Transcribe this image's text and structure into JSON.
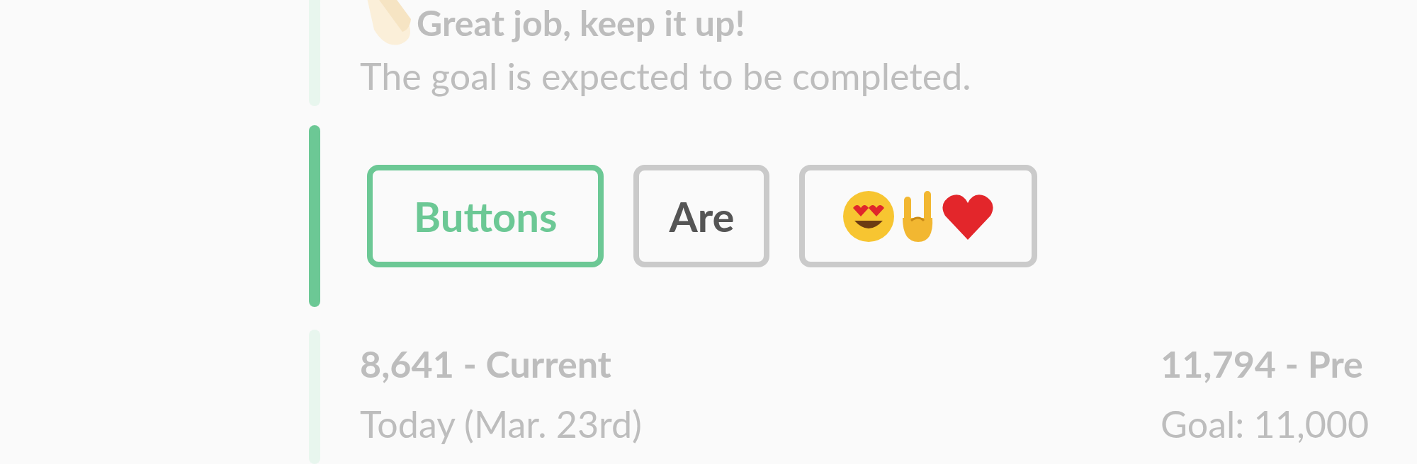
{
  "summary": {
    "active": false,
    "title": "Great job, keep it up!",
    "message": "The goal is expected to be completed."
  },
  "button_group": {
    "active": true,
    "buttons": [
      {
        "kind": "text",
        "label": "Buttons",
        "selected": true
      },
      {
        "kind": "text",
        "label": "Are",
        "selected": false
      },
      {
        "kind": "emoji",
        "selected": false
      }
    ]
  },
  "stats": {
    "active": false,
    "columns": [
      {
        "value": "8,641 - Current",
        "caption": "Today (Mar. 23rd)"
      },
      {
        "value": "11,794 - Pre",
        "caption": "Goal: 11,000"
      }
    ]
  }
}
